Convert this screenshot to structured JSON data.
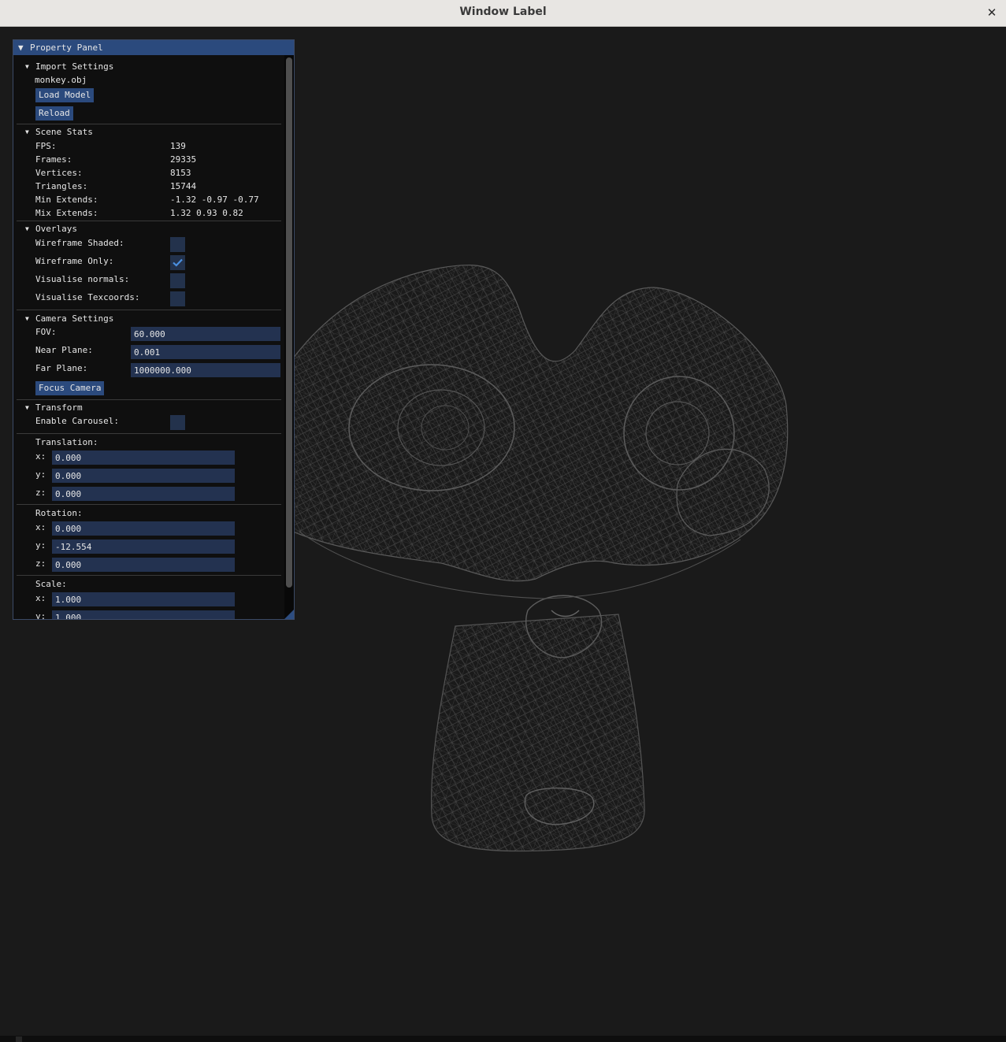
{
  "window": {
    "title": "Window Label",
    "close_glyph": "✕"
  },
  "panel": {
    "title": "Property Panel",
    "import": {
      "header": "Import Settings",
      "filename": "monkey.obj",
      "load_button": "Load Model",
      "reload_button": "Reload"
    },
    "stats": {
      "header": "Scene Stats",
      "rows": [
        {
          "label": "FPS:",
          "value": "139"
        },
        {
          "label": "Frames:",
          "value": "29335"
        },
        {
          "label": "Vertices:",
          "value": "8153"
        },
        {
          "label": "Triangles:",
          "value": "15744"
        },
        {
          "label": "Min Extends:",
          "value": "-1.32 -0.97 -0.77"
        },
        {
          "label": "Mix Extends:",
          "value": "1.32 0.93 0.82"
        }
      ]
    },
    "overlays": {
      "header": "Overlays",
      "items": [
        {
          "label": "Wireframe Shaded:",
          "checked": false
        },
        {
          "label": "Wireframe Only:",
          "checked": true
        },
        {
          "label": "Visualise normals:",
          "checked": false
        },
        {
          "label": "Visualise Texcoords:",
          "checked": false
        }
      ]
    },
    "camera": {
      "header": "Camera Settings",
      "fov_label": "FOV:",
      "fov_value": "60.000",
      "near_label": "Near Plane:",
      "near_value": "0.001",
      "far_label": "Far Plane:",
      "far_value": "1000000.000",
      "focus_button": "Focus Camera"
    },
    "transform": {
      "header": "Transform",
      "carousel_label": "Enable Carousel:",
      "carousel_checked": false,
      "translation": {
        "label": "Translation:",
        "x_label": "x:",
        "x": "0.000",
        "y_label": "y:",
        "y": "0.000",
        "z_label": "z:",
        "z": "0.000"
      },
      "rotation": {
        "label": "Rotation:",
        "x_label": "x:",
        "x": "0.000",
        "y_label": "y:",
        "y": "-12.554",
        "z_label": "z:",
        "z": "0.000"
      },
      "scale": {
        "label": "Scale:",
        "x_label": "x:",
        "x": "1.000",
        "y_label": "y:",
        "y": "1.000"
      }
    }
  },
  "colors": {
    "accent": "#2b4a7d",
    "field_bg": "#233250",
    "check_mark": "#4a90e2",
    "background": "#1a1a1a",
    "wireframe": "#5a5a5a"
  }
}
